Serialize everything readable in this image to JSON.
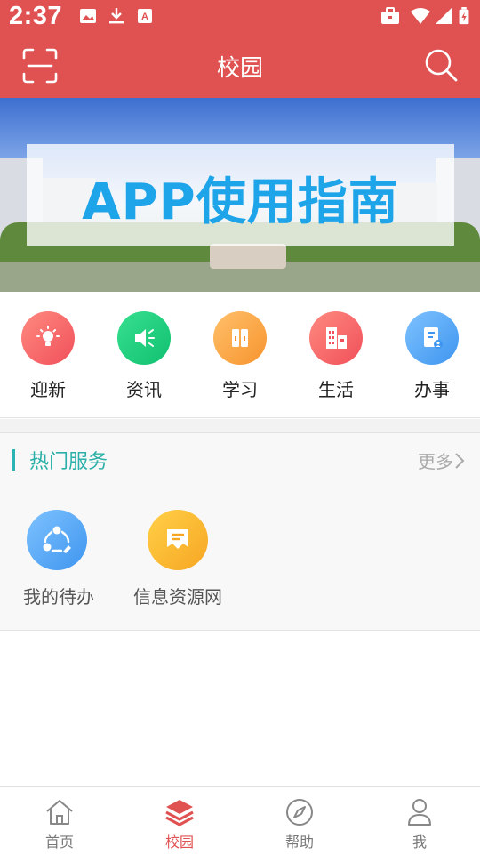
{
  "status_bar": {
    "time": "2:37"
  },
  "header": {
    "title": "校园"
  },
  "banner": {
    "text": "APP使用指南"
  },
  "quick_nav": [
    {
      "label": "迎新",
      "icon": "lightbulb-icon",
      "color_from": "#ff8a80",
      "color_to": "#f0505a"
    },
    {
      "label": "资讯",
      "icon": "megaphone-icon",
      "color_from": "#37e08f",
      "color_to": "#10c070"
    },
    {
      "label": "学习",
      "icon": "books-icon",
      "color_from": "#ffc06a",
      "color_to": "#f7942e"
    },
    {
      "label": "生活",
      "icon": "buildings-icon",
      "color_from": "#ff8a80",
      "color_to": "#f0505a"
    },
    {
      "label": "办事",
      "icon": "document-icon",
      "color_from": "#7ec2ff",
      "color_to": "#3e95ef"
    }
  ],
  "hot_services": {
    "title": "热门服务",
    "more_label": "更多",
    "items": [
      {
        "label": "我的待办",
        "icon": "share-network-icon",
        "color_from": "#7ec2ff",
        "color_to": "#3e95ef"
      },
      {
        "label": "信息资源网",
        "icon": "message-icon",
        "color_from": "#ffd046",
        "color_to": "#f7a623"
      }
    ]
  },
  "tab_bar": [
    {
      "label": "首页",
      "icon": "home-icon",
      "active": false
    },
    {
      "label": "校园",
      "icon": "layers-icon",
      "active": true
    },
    {
      "label": "帮助",
      "icon": "compass-icon",
      "active": false
    },
    {
      "label": "我",
      "icon": "person-icon",
      "active": false
    }
  ],
  "colors": {
    "primary": "#e05252",
    "accent": "#2ab0a8"
  }
}
